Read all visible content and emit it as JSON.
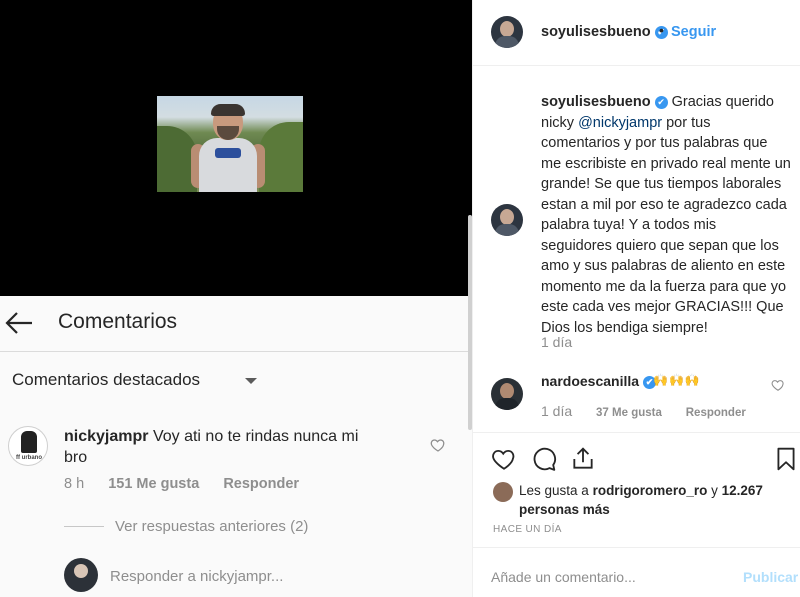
{
  "left": {
    "header": {
      "title": "Comentarios"
    },
    "filter": {
      "label": "Comentarios destacados"
    },
    "avatar_text": "ff urbano",
    "comment": {
      "username": "nickyjampr",
      "text": "Voy ati no te rindas nunca mi bro",
      "time": "8 h",
      "likes": "151 Me gusta",
      "reply": "Responder"
    },
    "previous_replies": "Ver respuestas anteriores (2)",
    "reply_placeholder": "Responder a nickyjampr..."
  },
  "post": {
    "header": {
      "username": "soyulisesbueno",
      "verified": "✔",
      "separator": "•",
      "follow": "Seguir"
    },
    "caption": {
      "username": "soyulisesbueno",
      "verified": "✔",
      "text_before": " Gracias querido nicky ",
      "mention": "@nickyjampr",
      "text_after": " por tus comentarios y por tus palabras que me escribiste en privado real mente un grande! Se que tus tiempos laborales estan a mil por eso te agradezco cada palabra tuya! Y a todos mis seguidores quiero que sepan que los amo y sus palabras de aliento en este momento me da la fuerza para que yo este cada ves mejor GRACIAS!!! Que Dios los bendiga siempre!",
      "time": "1 día"
    },
    "comment2": {
      "username": "nardoescanilla",
      "verified": "✔",
      "emoji": "🙌🙌🙌",
      "time": "1 día",
      "likes": "37 Me gusta",
      "reply": "Responder"
    },
    "likes": {
      "prefix": "Les gusta a ",
      "user": "rodrigoromero_ro",
      "mid": " y ",
      "count": "12.267 personas más"
    },
    "time_ago": "HACE UN DÍA",
    "add_comment_placeholder": "Añade un comentario...",
    "publish": "Publicar"
  },
  "colors": {
    "accent": "#3897f0",
    "text": "#262626",
    "muted": "#8e8e8e"
  },
  "icons": [
    "back-arrow-icon",
    "dropdown-caret-icon",
    "heart-icon",
    "comment-icon",
    "share-icon",
    "bookmark-icon",
    "verified-badge-icon"
  ]
}
